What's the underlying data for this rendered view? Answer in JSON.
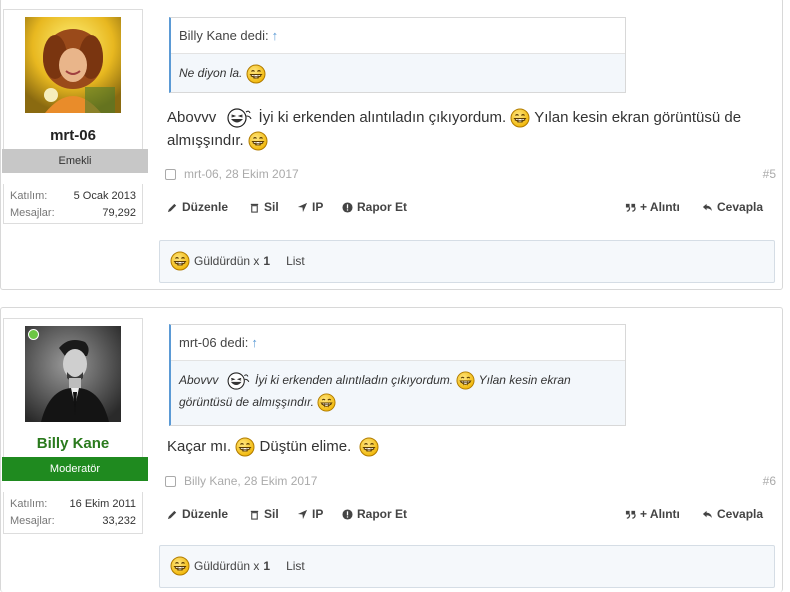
{
  "posts": [
    {
      "username": "mrt-06",
      "user_title": "Emekli",
      "online": false,
      "stats": [
        {
          "label": "Katılım:",
          "value": "5 Ocak 2013"
        },
        {
          "label": "Mesajlar:",
          "value": "79,292"
        }
      ],
      "quote": {
        "author": "Billy Kane dedi:",
        "arrow": "↑",
        "text": "Ne diyon la."
      },
      "message_parts": [
        "Abovvv",
        "İyi ki erkenden alıntıladın çıkıyordum.",
        "Yılan kesin ekran görüntüsü de almışşındır."
      ],
      "meta": {
        "author_date": "mrt-06, 28 Ekim 2017",
        "number": "#5"
      },
      "actions": {
        "edit": "Düzenle",
        "delete": "Sil",
        "ip": "IP",
        "report": "Rapor Et",
        "quote": "+ Alıntı",
        "reply": "Cevapla"
      },
      "likes": {
        "text": "Güldürdün x",
        "count": "1",
        "list": "List"
      }
    },
    {
      "username": "Billy Kane",
      "user_title": "Moderatör",
      "online": true,
      "stats": [
        {
          "label": "Katılım:",
          "value": "16 Ekim 2011"
        },
        {
          "label": "Mesajlar:",
          "value": "33,232"
        }
      ],
      "quote": {
        "author": "mrt-06 dedi:",
        "arrow": "↑",
        "text_parts": [
          "Abovvv",
          "İyi ki erkenden alıntıladın çıkıyordum.",
          "Yılan kesin ekran",
          "görüntüsü de almışşındır."
        ]
      },
      "message_parts": [
        "Kaçar mı.",
        "Düştün elime."
      ],
      "meta": {
        "author_date": "Billy Kane, 28 Ekim 2017",
        "number": "#6"
      },
      "actions": {
        "edit": "Düzenle",
        "delete": "Sil",
        "ip": "IP",
        "report": "Rapor Et",
        "quote": "+ Alıntı",
        "reply": "Cevapla"
      },
      "likes": {
        "text": "Güldürdün x",
        "count": "1",
        "list": "List"
      }
    }
  ],
  "colors": {
    "quote_border": "#5b9ad5",
    "moderator_green": "#1f8a1f",
    "retired_gray": "#c7c7c7",
    "likes_bg": "#f5f8fb"
  },
  "icons": [
    "pencil-icon",
    "trash-icon",
    "location-arrow-icon",
    "info-circle-icon",
    "quote-icon",
    "reply-icon",
    "laughing-smiley-icon",
    "grinning-smiley-icon"
  ]
}
